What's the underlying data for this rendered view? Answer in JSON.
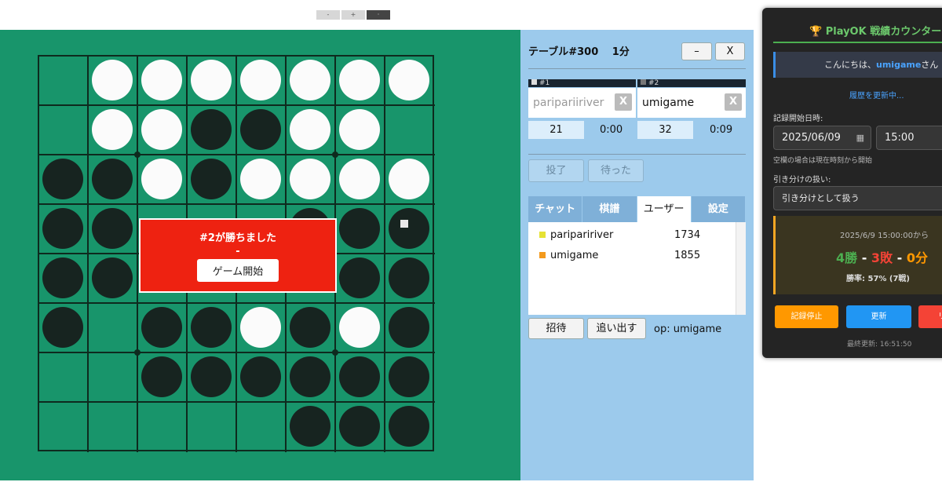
{
  "zoom_controls": [
    "-",
    "+",
    "·"
  ],
  "board": {
    "cells": [
      [
        "",
        "w",
        "w",
        "w",
        "w",
        "w",
        "w",
        "w"
      ],
      [
        "",
        "w",
        "w",
        "b",
        "b",
        "w",
        "w",
        ""
      ],
      [
        "b",
        "b",
        "w",
        "b",
        "w",
        "w",
        "w",
        "w"
      ],
      [
        "b",
        "b",
        "",
        "",
        "",
        "b",
        "b",
        "b"
      ],
      [
        "b",
        "b",
        "",
        "",
        "",
        "",
        "b",
        "b"
      ],
      [
        "b",
        "",
        "b",
        "b",
        "w",
        "b",
        "w",
        "b"
      ],
      [
        "",
        "",
        "b",
        "b",
        "b",
        "b",
        "b",
        "b"
      ],
      [
        "",
        "",
        "",
        "",
        "",
        "b",
        "b",
        "b"
      ]
    ],
    "last_move_marker": {
      "row": 3,
      "col": 7
    }
  },
  "overlay": {
    "message": "#2が勝ちました",
    "separator": "-",
    "start_button": "ゲーム開始"
  },
  "table": {
    "title": "テーブル#300　 1分",
    "minimize_label": "–",
    "close_label": "X",
    "seat1": {
      "header": "#1",
      "name": "paripariiriver",
      "remove": "X",
      "score": "21",
      "time": "0:00"
    },
    "seat2": {
      "header": "#2",
      "name": "umigame",
      "remove": "X",
      "score": "32",
      "time": "0:09"
    },
    "resign_label": "投了",
    "undo_label": "待った",
    "tabs": [
      "チャット",
      "棋譜",
      "ユーザー",
      "設定"
    ],
    "active_tab": 2,
    "users": [
      {
        "name": "paripaririver",
        "rating": "1734",
        "color": "#e6e234"
      },
      {
        "name": "umigame",
        "rating": "1855",
        "color": "#f39a1e"
      }
    ],
    "invite_label": "招待",
    "kick_label": "追い出す",
    "op_text": "op: umigame"
  },
  "counter": {
    "title": "🏆 PlayOK 戦績カウンター",
    "greeting_prefix": "こんにちは、",
    "greeting_user": "umigame",
    "greeting_suffix": "さん",
    "refreshing": "履歴を更新中...",
    "start_label": "記録開始日時:",
    "start_date": "2025/06/09",
    "start_time": "15:00",
    "hint": "空欄の場合は現在時刻から開始",
    "draw_label": "引き分けの扱い:",
    "draw_option": "引き分けとして扱う",
    "since": "2025/6/9 15:00:00から",
    "wins": "4勝",
    "sep1": " - ",
    "losses": "3敗",
    "sep2": " - ",
    "draws": "0分",
    "win_rate": "勝率: 57% (7戦)",
    "stop_button": "記録停止",
    "update_button": "更新",
    "reset_button": "リ",
    "last_updated": "最終更新: 16:51:50",
    "colors": {
      "win": "#4caf50",
      "loss": "#f44336",
      "draw": "#ff9800",
      "stop": "#ff9800",
      "update": "#2196f3",
      "reset": "#f44336"
    }
  }
}
